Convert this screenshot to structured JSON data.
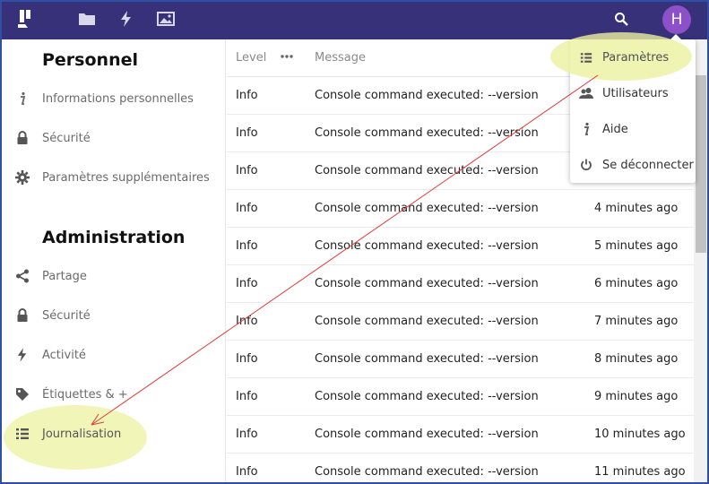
{
  "header": {
    "app_icons": [
      "logo-icon",
      "folder-icon",
      "activity-icon",
      "image-icon"
    ],
    "search_icon": "search-icon",
    "avatar_initial": "H",
    "avatar_color": "#8c50c8",
    "bar_color": "#373179"
  },
  "sidebar": {
    "personal_title": "Personnel",
    "personal_items": [
      {
        "label": "Informations personnelles",
        "icon": "info-icon"
      },
      {
        "label": "Sécurité",
        "icon": "lock-icon"
      },
      {
        "label": "Paramètres supplémentaires",
        "icon": "gear-icon"
      }
    ],
    "admin_title": "Administration",
    "admin_items": [
      {
        "label": "Partage",
        "icon": "share-icon"
      },
      {
        "label": "Sécurité",
        "icon": "lock-icon"
      },
      {
        "label": "Activité",
        "icon": "activity-icon"
      },
      {
        "label": "Étiquettes & +",
        "icon": "tag-icon"
      },
      {
        "label": "Journalisation",
        "icon": "list-icon",
        "selected": true
      }
    ]
  },
  "log_table": {
    "headers": {
      "level": "Level",
      "message": "Message"
    },
    "more_icon": "more-icon",
    "rows": [
      {
        "level": "Info",
        "message": "Console command executed: --version",
        "time": ""
      },
      {
        "level": "Info",
        "message": "Console command executed: --version",
        "time": ""
      },
      {
        "level": "Info",
        "message": "Console command executed: --version",
        "time": ""
      },
      {
        "level": "Info",
        "message": "Console command executed: --version",
        "time": "4 minutes ago"
      },
      {
        "level": "Info",
        "message": "Console command executed: --version",
        "time": "5 minutes ago"
      },
      {
        "level": "Info",
        "message": "Console command executed: --version",
        "time": "6 minutes ago"
      },
      {
        "level": "Info",
        "message": "Console command executed: --version",
        "time": "7 minutes ago"
      },
      {
        "level": "Info",
        "message": "Console command executed: --version",
        "time": "8 minutes ago"
      },
      {
        "level": "Info",
        "message": "Console command executed: --version",
        "time": "9 minutes ago"
      },
      {
        "level": "Info",
        "message": "Console command executed: --version",
        "time": "10 minutes ago"
      },
      {
        "level": "Info",
        "message": "Console command executed: --version",
        "time": "11 minutes ago"
      }
    ]
  },
  "user_menu": {
    "items": [
      {
        "label": "Paramètres",
        "icon": "settings-list-icon",
        "highlighted": true
      },
      {
        "label": "Utilisateurs",
        "icon": "users-icon"
      },
      {
        "label": "Aide",
        "icon": "info-icon"
      },
      {
        "label": "Se déconnecter",
        "icon": "power-icon"
      }
    ]
  },
  "annotation": {
    "highlight_color": "#ecf1a0",
    "arrow_color": "#e03a3a"
  }
}
